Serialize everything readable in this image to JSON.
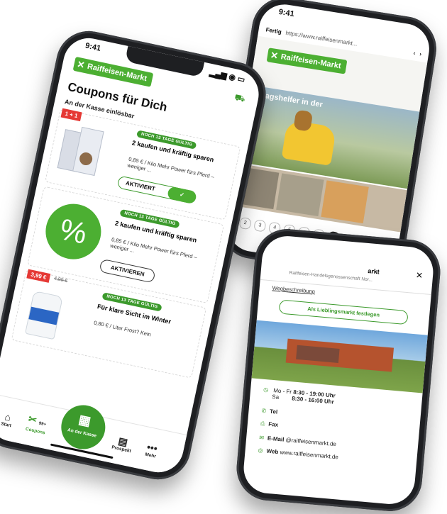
{
  "colors": {
    "brand_green": "#4caf32",
    "badge_green": "#3c9a2c",
    "price_red": "#e53935"
  },
  "phone_main": {
    "time": "9:41",
    "logo": "Raiffeisen-Markt",
    "page_title": "Coupons für Dich",
    "subtitle": "An der Kasse einlösbar",
    "coupons": [
      {
        "tag": "1 + 1",
        "badge": "NOCH 13 TAGE GÜLTIG",
        "title": "2 kaufen und kräftig sparen",
        "desc": "0,85 € / Kilo Mehr Power fürs Pferd – weniger ...",
        "button": "AKTIVIERT",
        "icon": "product-image"
      },
      {
        "badge": "NOCH 13 TAGE GÜLTIG",
        "title": "2 kaufen und kräftig sparen",
        "desc": "0,85 € / Kilo Mehr Power fürs Pferd – weniger ...",
        "button": "AKTIVIEREN",
        "icon": "percent-icon"
      },
      {
        "price": "3,99 €",
        "old_price": "4,99 €",
        "badge": "NOCH 13 TAGE GÜLTIG",
        "title": "Für klare Sicht im Winter",
        "desc": "0,80 € / Liter Frost? Kein"
      }
    ],
    "tabs": {
      "start": "Start",
      "coupons": "Coupons",
      "coupons_count": "99+",
      "kasse": "An der Kasse",
      "prospekt": "Prospekt",
      "mehr": "Mehr"
    }
  },
  "phone_browser": {
    "time": "9:41",
    "done": "Fertig",
    "url": "https://www.raiffeisenmarkt...",
    "logo": "Raiffeisen-Markt",
    "hero_text": "Alltagshelfer in der",
    "pages": [
      "2",
      "3",
      "4",
      "5",
      "…",
      "8"
    ]
  },
  "phone_detail": {
    "title_partial": "arkt",
    "subtitle_partial": "Raiffeisen-Handelsgenossenschaft Nor...",
    "link": "Wegbeschreibung",
    "fav_button": "Als Lieblingsmarkt festlegen",
    "hours": [
      {
        "days": "Mo - Fr",
        "time": "8:30 - 19:00 Uhr"
      },
      {
        "days": "Sa",
        "time": "8:30 - 16:00 Uhr"
      }
    ],
    "tel": "Tel",
    "fax": "Fax",
    "email_label": "E-Mail",
    "email": "@raiffeisenmarkt.de",
    "web_label": "Web",
    "web": "www.raiffeisenmarkt.de"
  }
}
